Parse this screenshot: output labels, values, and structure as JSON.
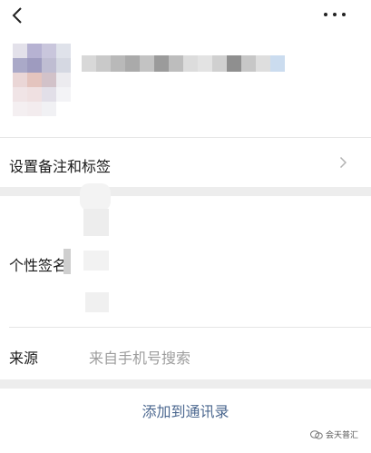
{
  "nav": {
    "back_icon": "chevron-left-icon",
    "more_icon": "more-dots-icon"
  },
  "profile": {
    "avatar": "blurred-avatar",
    "name_blurred": true
  },
  "remark_row": {
    "label": "设置备注和标签",
    "chevron_icon": "chevron-right-icon"
  },
  "signature_row": {
    "label": "个性签名"
  },
  "source_row": {
    "label": "来源",
    "value": "来自手机号搜索"
  },
  "add_contact": {
    "label": "添加到通讯录"
  },
  "watermark": {
    "text": "会天普汇",
    "icon": "wechat-icon"
  },
  "colors": {
    "background": "#ededed",
    "panel": "#ffffff",
    "link": "#4c6890",
    "muted": "#9d9d9d"
  }
}
